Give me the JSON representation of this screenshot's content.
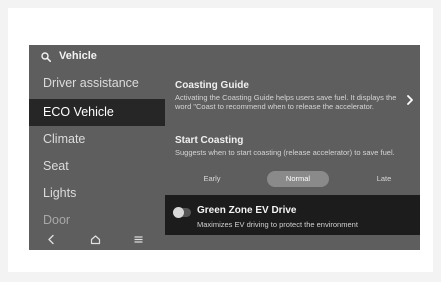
{
  "header": {
    "title": "Vehicle",
    "icon": "search-icon"
  },
  "sidebar": {
    "items": [
      {
        "label": "Driver assistance"
      },
      {
        "label": "ECO Vehicle",
        "active": true
      },
      {
        "label": "Climate"
      },
      {
        "label": "Seat"
      },
      {
        "label": "Lights"
      },
      {
        "label": "Door"
      }
    ]
  },
  "main": {
    "coasting_guide": {
      "title": "Coasting Guide",
      "description": "Activating the Coasting Guide helps users save fuel. It displays the word \"Coast to recommend when to release the accelerator.",
      "icon": "chevron-right-icon"
    },
    "start_coasting": {
      "title": "Start Coasting",
      "description": "Suggests when to start coasting (release accelerator) to save fuel.",
      "options": [
        "Early",
        "Normal",
        "Late"
      ],
      "selected": "Normal"
    }
  },
  "toast": {
    "title": "Green Zone EV Drive",
    "description": "Maximizes EV driving to protect the environment",
    "toggle_state": "off"
  },
  "bottom_bar": {
    "icons": [
      "back-icon",
      "home-icon",
      "menu-icon"
    ]
  },
  "colors": {
    "screen_bg": "#5e5e5e",
    "active_item_bg": "#262626",
    "toast_bg": "#1c1c1c",
    "selected_option_bg": "#8a8a8a"
  }
}
